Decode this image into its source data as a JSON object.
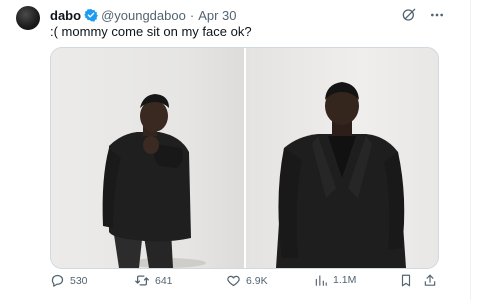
{
  "tweet": {
    "display_name": "dabo",
    "handle": "@youngdaboo",
    "separator": "·",
    "date": "Apr 30",
    "text": ":( mommy come sit on my face ok?"
  },
  "media": {
    "photos": [
      {
        "icon": "photo-person-hand-to-face"
      },
      {
        "icon": "photo-person-black-suit"
      }
    ]
  },
  "actions": {
    "replies": "530",
    "reposts": "641",
    "likes": "6.9K",
    "views": "1.1M"
  },
  "colors": {
    "accent": "#1d9bf0",
    "muted": "#536471",
    "text": "#0f1419",
    "border": "#cfd9de"
  }
}
